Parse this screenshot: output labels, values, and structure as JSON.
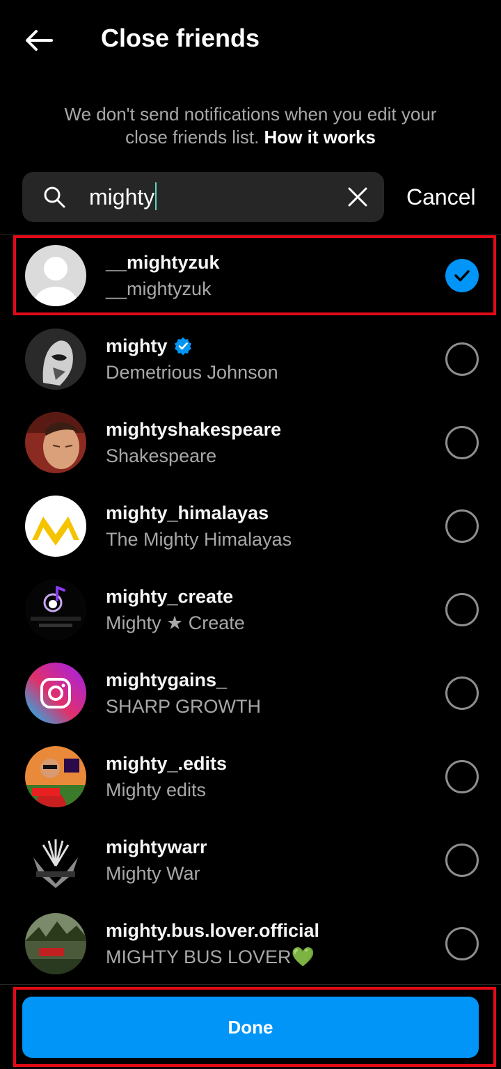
{
  "header": {
    "title": "Close friends"
  },
  "notice": {
    "text": "We don't send notifications when you edit your close friends list.",
    "link": "How it works"
  },
  "search": {
    "value": "mighty",
    "cancel_label": "Cancel"
  },
  "results": [
    {
      "username": "__mightyzuk",
      "full_name": "__mightyzuk",
      "verified": false,
      "selected": true,
      "avatar": "default-avatar"
    },
    {
      "username": "mighty",
      "full_name": "Demetrious Johnson",
      "verified": true,
      "selected": false,
      "avatar": "photo-avatar"
    },
    {
      "username": "mightyshakespeare",
      "full_name": "Shakespeare",
      "verified": false,
      "selected": false,
      "avatar": "photo-avatar"
    },
    {
      "username": "mighty_himalayas",
      "full_name": "The Mighty Himalayas",
      "verified": false,
      "selected": false,
      "avatar": "logo-avatar"
    },
    {
      "username": "mighty_create",
      "full_name": "Mighty ★ Create",
      "verified": false,
      "selected": false,
      "avatar": "logo-avatar"
    },
    {
      "username": "mightygains_",
      "full_name": "SHARP GROWTH",
      "verified": false,
      "selected": false,
      "avatar": "instagram-logo-avatar"
    },
    {
      "username": "mighty_.edits",
      "full_name": "Mighty edits",
      "verified": false,
      "selected": false,
      "avatar": "photo-avatar"
    },
    {
      "username": "mightywarr",
      "full_name": "Mighty War",
      "verified": false,
      "selected": false,
      "avatar": "logo-avatar"
    },
    {
      "username": "mighty.bus.lover.official",
      "full_name": "MIGHTY BUS LOVER💚",
      "verified": false,
      "selected": false,
      "avatar": "photo-avatar"
    }
  ],
  "footer": {
    "done_label": "Done"
  },
  "colors": {
    "accent": "#0095f6",
    "highlight": "#e30a17",
    "background": "#000000",
    "search_bg": "#262626"
  }
}
